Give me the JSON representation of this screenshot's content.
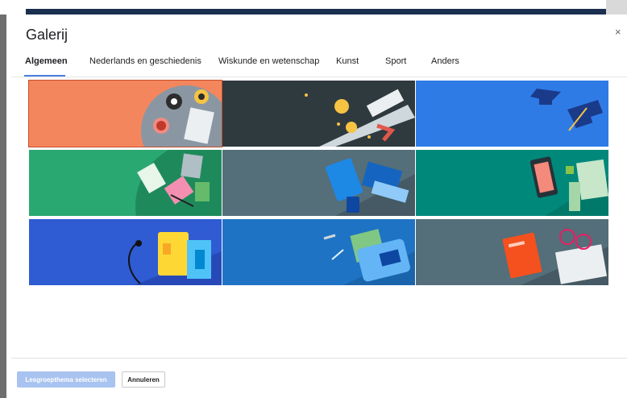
{
  "dialog": {
    "title": "Galerij",
    "close_label": "×"
  },
  "tabs": [
    {
      "label": "Algemeen",
      "active": true
    },
    {
      "label": "Nederlands en geschiedenis",
      "active": false
    },
    {
      "label": "Wiskunde en wetenschap",
      "active": false
    },
    {
      "label": "Kunst",
      "active": false
    },
    {
      "label": "Sport",
      "active": false
    },
    {
      "label": "Anders",
      "active": false
    }
  ],
  "gallery": {
    "themes": [
      {
        "name": "tea-breakfast-theme-image",
        "background": "#f4865e"
      },
      {
        "name": "graduation-diploma-theme-image",
        "background": "#2f3a3e"
      },
      {
        "name": "graduation-caps-theme-image",
        "background": "#2e7be6"
      },
      {
        "name": "books-notebooks-theme-image",
        "background": "#2aa871"
      },
      {
        "name": "laptop-tablet-theme-image",
        "background": "#546e7a"
      },
      {
        "name": "phone-notes-theme-image",
        "background": "#00897b"
      },
      {
        "name": "headphones-notebook-theme-image",
        "background": "#2f5bd3"
      },
      {
        "name": "backpack-theme-image",
        "background": "#1f73c4"
      },
      {
        "name": "book-glasses-newspaper-theme-image",
        "background": "#546e7a"
      }
    ]
  },
  "footer": {
    "primary_label": "Lesgroepthema selecteren",
    "secondary_label": "Annuleren"
  },
  "colors": {
    "accent": "#4a7fe1",
    "primary_disabled": "#a8c3ef",
    "header_bar": "#1a2f4e"
  }
}
